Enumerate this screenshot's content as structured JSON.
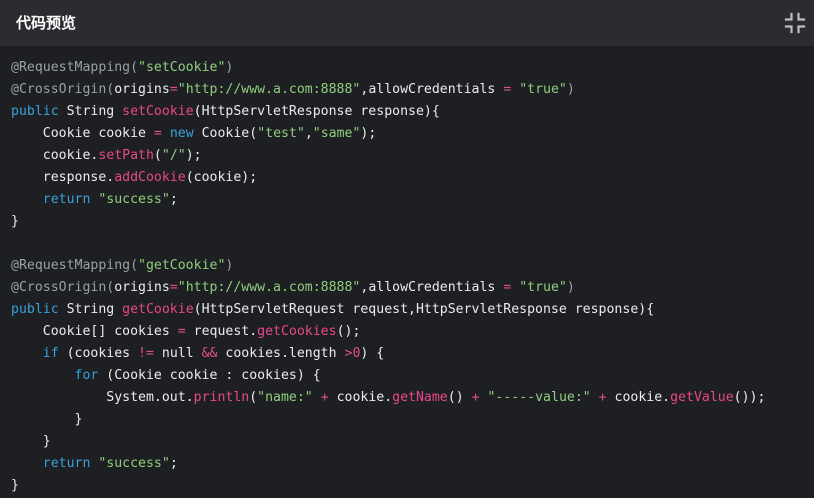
{
  "header": {
    "title": "代码预览",
    "collapse_icon": "collapse-icon"
  },
  "colors": {
    "background": "#1e1f22",
    "header": "#2c2c30",
    "annotation": "#9aa0a6",
    "string": "#8fce7e",
    "keyword": "#3aa0d9",
    "function": "#e8488a"
  },
  "code": {
    "lines": [
      [
        [
          "ann",
          "@RequestMapping("
        ],
        [
          "str",
          "\"setCookie\""
        ],
        [
          "ann",
          ")"
        ]
      ],
      [
        [
          "ann",
          "@CrossOrigin("
        ],
        [
          "pl",
          "origins"
        ],
        [
          "op",
          "="
        ],
        [
          "str",
          "\"http://www.a.com:8888\""
        ],
        [
          "pl",
          ",allowCredentials "
        ],
        [
          "op",
          "="
        ],
        [
          "pl",
          " "
        ],
        [
          "str",
          "\"true\""
        ],
        [
          "ann",
          ")"
        ]
      ],
      [
        [
          "kw",
          "public"
        ],
        [
          "pl",
          " String "
        ],
        [
          "fn",
          "setCookie"
        ],
        [
          "pl",
          "(HttpServletResponse response){"
        ]
      ],
      [
        [
          "pl",
          "    Cookie cookie "
        ],
        [
          "op",
          "="
        ],
        [
          "pl",
          " "
        ],
        [
          "kw",
          "new"
        ],
        [
          "pl",
          " Cookie("
        ],
        [
          "str",
          "\"test\""
        ],
        [
          "pl",
          ","
        ],
        [
          "str",
          "\"same\""
        ],
        [
          "pl",
          ");"
        ]
      ],
      [
        [
          "pl",
          "    cookie."
        ],
        [
          "fn",
          "setPath"
        ],
        [
          "pl",
          "("
        ],
        [
          "str",
          "\"/\""
        ],
        [
          "pl",
          ");"
        ]
      ],
      [
        [
          "pl",
          "    response."
        ],
        [
          "fn",
          "addCookie"
        ],
        [
          "pl",
          "(cookie);"
        ]
      ],
      [
        [
          "kw",
          "    return"
        ],
        [
          "pl",
          " "
        ],
        [
          "str",
          "\"success\""
        ],
        [
          "pl",
          ";"
        ]
      ],
      [
        [
          "pl",
          "}"
        ]
      ],
      [],
      [
        [
          "ann",
          "@RequestMapping("
        ],
        [
          "str",
          "\"getCookie\""
        ],
        [
          "ann",
          ")"
        ]
      ],
      [
        [
          "ann",
          "@CrossOrigin("
        ],
        [
          "pl",
          "origins"
        ],
        [
          "op",
          "="
        ],
        [
          "str",
          "\"http://www.a.com:8888\""
        ],
        [
          "pl",
          ",allowCredentials "
        ],
        [
          "op",
          "="
        ],
        [
          "pl",
          " "
        ],
        [
          "str",
          "\"true\""
        ],
        [
          "ann",
          ")"
        ]
      ],
      [
        [
          "kw",
          "public"
        ],
        [
          "pl",
          " String "
        ],
        [
          "fn",
          "getCookie"
        ],
        [
          "pl",
          "(HttpServletRequest request,HttpServletResponse response){"
        ]
      ],
      [
        [
          "pl",
          "    Cookie[] cookies "
        ],
        [
          "op",
          "="
        ],
        [
          "pl",
          " request."
        ],
        [
          "fn",
          "getCookies"
        ],
        [
          "pl",
          "();"
        ]
      ],
      [
        [
          "kw",
          "    if"
        ],
        [
          "pl",
          " (cookies "
        ],
        [
          "op",
          "!="
        ],
        [
          "pl",
          " null "
        ],
        [
          "op",
          "&&"
        ],
        [
          "pl",
          " cookies.length "
        ],
        [
          "op",
          ">"
        ],
        [
          "num",
          "0"
        ],
        [
          "pl",
          ") {"
        ]
      ],
      [
        [
          "kw",
          "        for"
        ],
        [
          "pl",
          " (Cookie cookie : cookies) {"
        ]
      ],
      [
        [
          "pl",
          "            System.out."
        ],
        [
          "fn",
          "println"
        ],
        [
          "pl",
          "("
        ],
        [
          "str",
          "\"name:\""
        ],
        [
          "pl",
          " "
        ],
        [
          "op",
          "+"
        ],
        [
          "pl",
          " cookie."
        ],
        [
          "fn",
          "getName"
        ],
        [
          "pl",
          "() "
        ],
        [
          "op",
          "+"
        ],
        [
          "pl",
          " "
        ],
        [
          "str",
          "\"-----value:\""
        ],
        [
          "pl",
          " "
        ],
        [
          "op",
          "+"
        ],
        [
          "pl",
          " cookie."
        ],
        [
          "fn",
          "getValue"
        ],
        [
          "pl",
          "());"
        ]
      ],
      [
        [
          "pl",
          "        }"
        ]
      ],
      [
        [
          "pl",
          "    }"
        ]
      ],
      [
        [
          "kw",
          "    return"
        ],
        [
          "pl",
          " "
        ],
        [
          "str",
          "\"success\""
        ],
        [
          "pl",
          ";"
        ]
      ],
      [
        [
          "pl",
          "}"
        ]
      ]
    ]
  }
}
